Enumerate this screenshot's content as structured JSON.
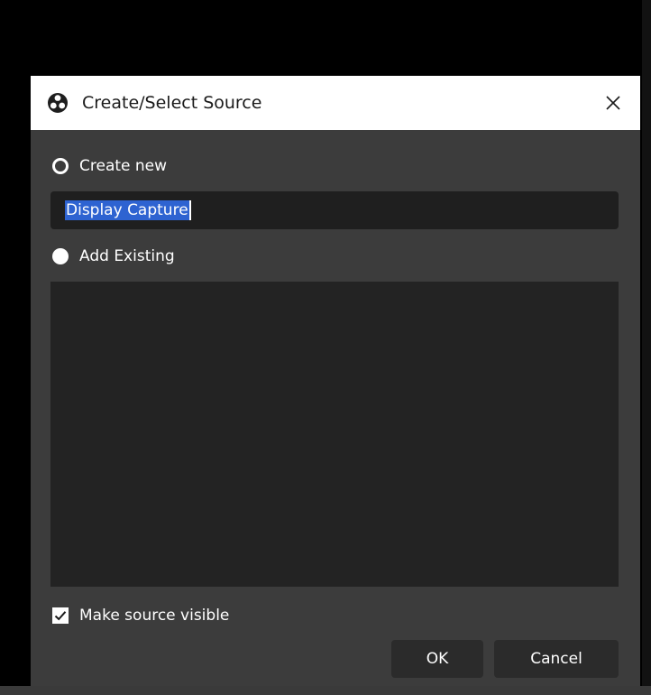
{
  "dialog": {
    "title": "Create/Select Source",
    "close_icon": "close-icon",
    "logo_icon": "obs-logo-icon"
  },
  "create_new": {
    "label": "Create new",
    "selected": false
  },
  "name_input": {
    "value": "Display Capture",
    "text_selected": true
  },
  "add_existing": {
    "label": "Add Existing",
    "selected": true,
    "items": []
  },
  "make_visible": {
    "label": "Make source visible",
    "checked": true
  },
  "buttons": {
    "ok_label": "OK",
    "cancel_label": "Cancel"
  },
  "colors": {
    "dialog_bg": "#3c3c3c",
    "input_bg": "#1f1f1f",
    "selection": "#2e63d1",
    "button_bg": "#2b2b2b"
  }
}
